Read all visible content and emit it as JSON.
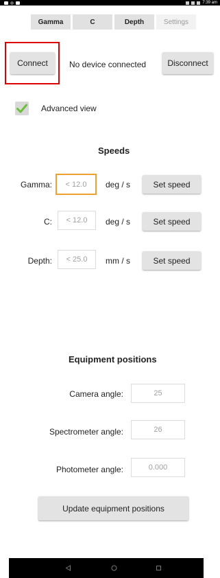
{
  "status_bar": {
    "time": "7:39 am"
  },
  "tabs": [
    {
      "label": "Gamma",
      "active": true
    },
    {
      "label": "C",
      "active": true
    },
    {
      "label": "Depth",
      "active": true
    },
    {
      "label": "Settings",
      "active": false
    }
  ],
  "connection": {
    "connect_label": "Connect",
    "status_text": "No device connected",
    "disconnect_label": "Disconnect",
    "highlight_color": "#e00000"
  },
  "advanced_view": {
    "label": "Advanced view",
    "checked": true,
    "check_color": "#6cbf3c"
  },
  "speeds": {
    "title": "Speeds",
    "rows": [
      {
        "label": "Gamma:",
        "placeholder": "< 12.0",
        "unit": "deg / s",
        "button": "Set speed",
        "focused": true
      },
      {
        "label": "C:",
        "placeholder": "< 12.0",
        "unit": "deg / s",
        "button": "Set speed",
        "focused": false
      },
      {
        "label": "Depth:",
        "placeholder": "< 25.0",
        "unit": "mm / s",
        "button": "Set speed",
        "focused": false
      }
    ],
    "focus_color": "#f0a030"
  },
  "equipment": {
    "title": "Equipment positions",
    "rows": [
      {
        "label": "Camera angle:",
        "value": "25"
      },
      {
        "label": "Spectrometer angle:",
        "value": "26"
      },
      {
        "label": "Photometer angle:",
        "value": "0.000"
      }
    ],
    "update_label": "Update equipment positions"
  },
  "nav_bar": {
    "icons": [
      "back-icon",
      "home-icon",
      "recents-icon"
    ]
  }
}
